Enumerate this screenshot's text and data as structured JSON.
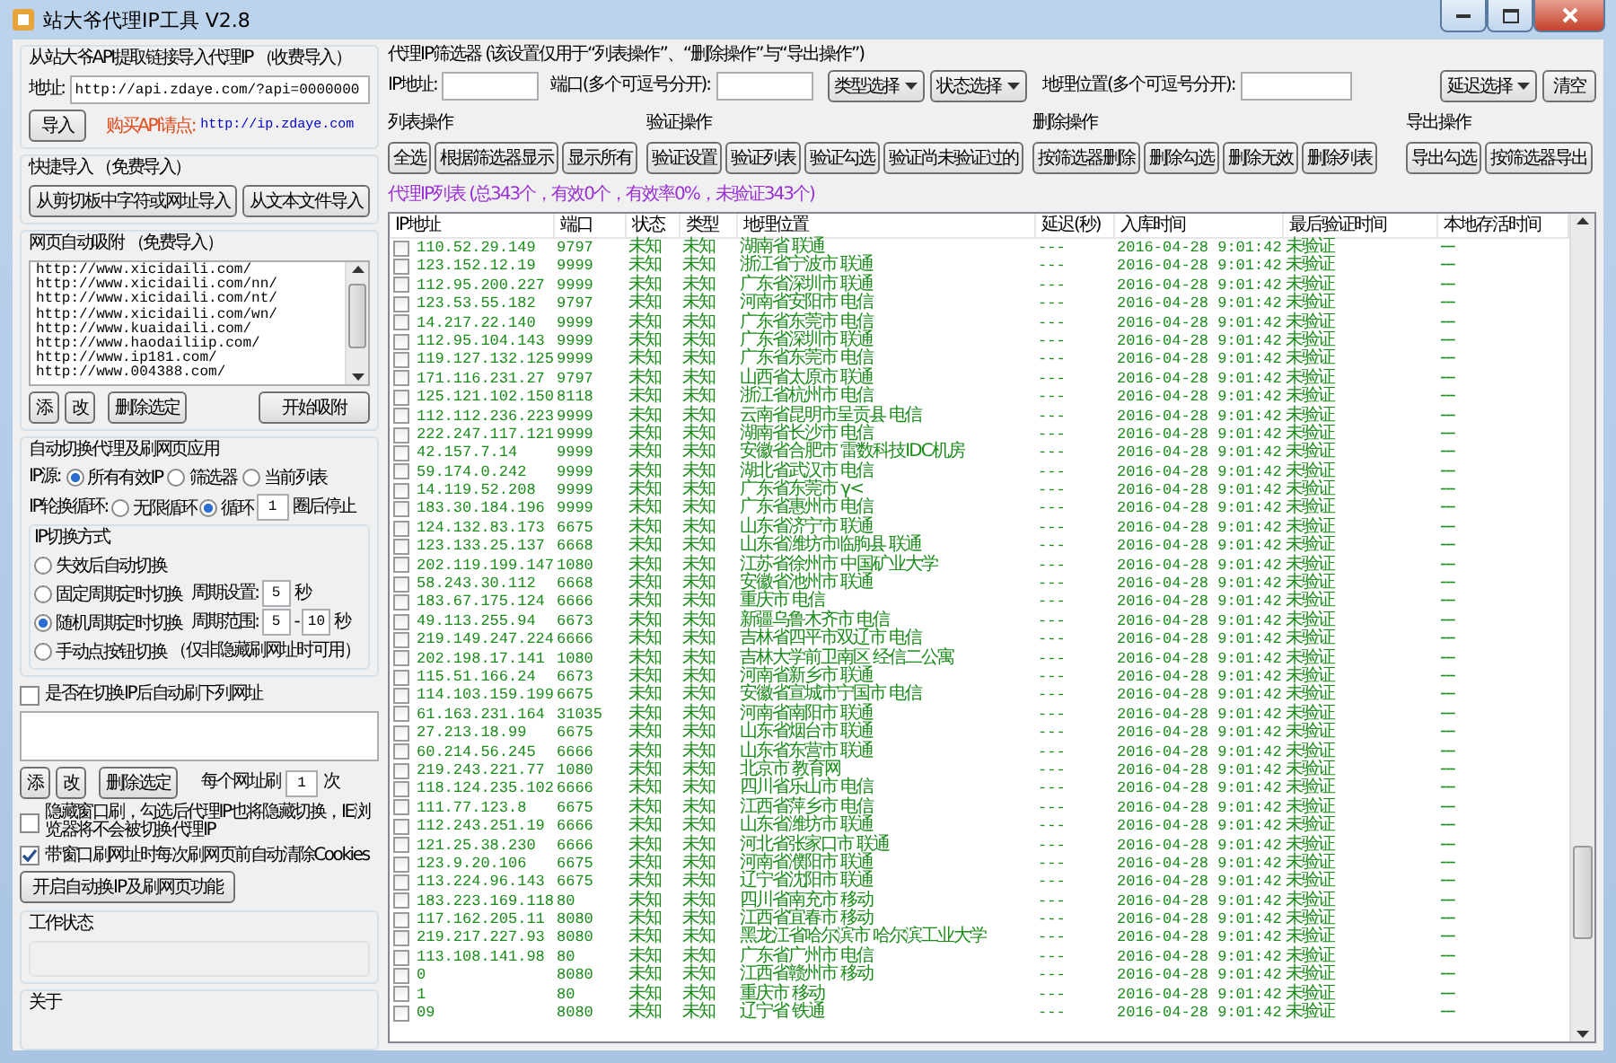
{
  "window": {
    "title": "站大爷代理IP工具 V2.8"
  },
  "api_import": {
    "title": "从站大爷API提取链接导入代理IP （收费导入）",
    "address_label": "地址:",
    "address_value": "http://api.zdaye.com/?api=0000000",
    "import_button": "导入",
    "buy_label": "购买API请点:",
    "buy_link": "http://ip.zdaye.com"
  },
  "quick_import": {
    "title": "快捷导入 （免费导入）",
    "buttons": [
      "从剪切板中字符或网址导入",
      "从文本文件导入"
    ]
  },
  "web_capture": {
    "title": "网页自动吸附 （免费导入）",
    "urls": [
      "http://www.xicidaili.com/",
      "http://www.xicidaili.com/nn/",
      "http://www.xicidaili.com/nt/",
      "http://www.xicidaili.com/wn/",
      "http://www.kuaidaili.com/",
      "http://www.haodailiip.com/",
      "http://www.ip181.com/",
      "http://www.004388.com/"
    ],
    "buttons": [
      "添",
      "改",
      "删除选定"
    ],
    "start_button": "开始吸附"
  },
  "auto_switch": {
    "title": "自动切换代理及刷网页应用",
    "ip_source": {
      "label": "IP源:",
      "options": [
        {
          "label": "所有有效IP",
          "selected": true
        },
        {
          "label": "筛选器",
          "selected": false
        },
        {
          "label": "当前列表",
          "selected": false
        }
      ]
    },
    "rotation": {
      "label": "IP轮换循环:",
      "options": [
        {
          "label": "无限循环",
          "selected": false
        },
        {
          "label": "循环",
          "selected": true
        }
      ],
      "count": "1",
      "suffix": "圈后停止"
    },
    "mode": {
      "title": "IP切换方式",
      "options": [
        {
          "kind": "plain",
          "label": "失效后自动切换",
          "selected": false
        },
        {
          "kind": "fixed",
          "label": "固定周期定时切换",
          "selected": false,
          "field_label": "周期设置:",
          "value": "5",
          "unit": "秒"
        },
        {
          "kind": "range",
          "label": "随机周期定时切换",
          "selected": true,
          "field_label": "周期范围:",
          "from": "5",
          "dash": "-",
          "to": "10",
          "unit": "秒"
        },
        {
          "kind": "note",
          "label": "手动点按钮切换",
          "selected": false,
          "note": "（仅非隐藏刷网址时可用）"
        }
      ]
    }
  },
  "refresh": {
    "checkbox": {
      "label": "是否在切换IP后自动刷下列网址",
      "checked": false
    },
    "buttons": [
      "添",
      "改",
      "删除选定"
    ],
    "count_label": "每个网址刷",
    "count": "1",
    "count_unit": "次"
  },
  "options": [
    {
      "label": "隐藏窗口刷，勾选后代理IP也将隐藏切换，IE浏览器将不会被切换代理IP",
      "checked": false
    },
    {
      "label": "带窗口刷网址时每次刷网页前自动清除Cookies",
      "checked": true
    }
  ],
  "start_button": "开启自动换IP及刷网页功能",
  "status_group": {
    "title": "工作状态"
  },
  "about_group": {
    "title": "关于"
  },
  "filter": {
    "title": "代理IP筛选器 (该设置仅用于“列表操作”、“删除操作”与“导出操作”)",
    "ip_label": "IP地址:",
    "port_label": "端口(多个可逗号分开):",
    "type_select": "类型选择",
    "status_select": "状态选择",
    "location_label": "地理位置(多个可逗号分开):",
    "delay_select": "延迟选择",
    "clear_button": "清空"
  },
  "actions": [
    {
      "title": "列表操作",
      "buttons": [
        "全选",
        "根据筛选器显示",
        "显示所有"
      ]
    },
    {
      "title": "验证操作",
      "buttons": [
        "验证设置",
        "验证列表",
        "验证勾选",
        "验证尚未验证过的"
      ]
    },
    {
      "title": "删除操作",
      "buttons": [
        "按筛选器删除",
        "删除勾选",
        "删除无效",
        "删除列表"
      ]
    },
    {
      "title": "导出操作",
      "buttons": [
        "导出勾选",
        "按筛选器导出"
      ]
    }
  ],
  "list_summary": "代理IP列表 (总343个，有效0个，有效率0%，未验证343个)",
  "table": {
    "columns": [
      "IP地址",
      "端口",
      "状态",
      "类型",
      "地理位置",
      "延迟(秒)",
      "入库时间",
      "最后验证时间",
      "本地存活时间"
    ],
    "rows": [
      {
        "checked": false,
        "cells": [
          "110.52.29.149",
          "9797",
          "未知",
          "未知",
          "湖南省 联通",
          "---",
          "2016-04-28 9:01:42",
          "未验证",
          "---"
        ]
      },
      {
        "checked": false,
        "cells": [
          "123.152.12.19",
          "9999",
          "未知",
          "未知",
          "浙江省宁波市 联通",
          "---",
          "2016-04-28 9:01:42",
          "未验证",
          "---"
        ]
      },
      {
        "checked": false,
        "cells": [
          "112.95.200.227",
          "9999",
          "未知",
          "未知",
          "广东省深圳市 联通",
          "---",
          "2016-04-28 9:01:42",
          "未验证",
          "---"
        ]
      },
      {
        "checked": false,
        "cells": [
          "123.53.55.182",
          "9797",
          "未知",
          "未知",
          "河南省安阳市 电信",
          "---",
          "2016-04-28 9:01:42",
          "未验证",
          "---"
        ]
      },
      {
        "checked": false,
        "cells": [
          "14.217.22.140",
          "9999",
          "未知",
          "未知",
          "广东省东莞市 电信",
          "---",
          "2016-04-28 9:01:42",
          "未验证",
          "---"
        ]
      },
      {
        "checked": false,
        "cells": [
          "112.95.104.143",
          "9999",
          "未知",
          "未知",
          "广东省深圳市 联通",
          "---",
          "2016-04-28 9:01:42",
          "未验证",
          "---"
        ]
      },
      {
        "checked": false,
        "cells": [
          "119.127.132.125",
          "9999",
          "未知",
          "未知",
          "广东省东莞市 电信",
          "---",
          "2016-04-28 9:01:42",
          "未验证",
          "---"
        ]
      },
      {
        "checked": false,
        "cells": [
          "171.116.231.27",
          "9797",
          "未知",
          "未知",
          "山西省太原市 联通",
          "---",
          "2016-04-28 9:01:42",
          "未验证",
          "---"
        ]
      },
      {
        "checked": false,
        "cells": [
          "125.121.102.150",
          "8118",
          "未知",
          "未知",
          "浙江省杭州市 电信",
          "---",
          "2016-04-28 9:01:42",
          "未验证",
          "---"
        ]
      },
      {
        "checked": false,
        "cells": [
          "112.112.236.223",
          "9999",
          "未知",
          "未知",
          "云南省昆明市呈贡县 电信",
          "---",
          "2016-04-28 9:01:42",
          "未验证",
          "---"
        ]
      },
      {
        "checked": false,
        "cells": [
          "222.247.117.121",
          "9999",
          "未知",
          "未知",
          "湖南省长沙市 电信",
          "---",
          "2016-04-28 9:01:42",
          "未验证",
          "---"
        ]
      },
      {
        "checked": false,
        "cells": [
          "42.157.7.14",
          "9999",
          "未知",
          "未知",
          "安徽省合肥市 雷数科技IDC机房",
          "---",
          "2016-04-28 9:01:42",
          "未验证",
          "---"
        ]
      },
      {
        "checked": false,
        "cells": [
          "59.174.0.242",
          "9999",
          "未知",
          "未知",
          "湖北省武汉市 电信",
          "---",
          "2016-04-28 9:01:42",
          "未验证",
          "---"
        ]
      },
      {
        "checked": false,
        "cells": [
          "14.119.52.208",
          "9999",
          "未知",
          "未知",
          "广东省东莞市 γ<",
          "---",
          "2016-04-28 9:01:42",
          "未验证",
          "---"
        ]
      },
      {
        "checked": false,
        "cells": [
          "183.30.184.196",
          "9999",
          "未知",
          "未知",
          "广东省惠州市 电信",
          "---",
          "2016-04-28 9:01:42",
          "未验证",
          "---"
        ]
      },
      {
        "checked": false,
        "cells": [
          "124.132.83.173",
          "6675",
          "未知",
          "未知",
          "山东省济宁市 联通",
          "---",
          "2016-04-28 9:01:42",
          "未验证",
          "---"
        ]
      },
      {
        "checked": false,
        "cells": [
          "123.133.25.137",
          "6668",
          "未知",
          "未知",
          "山东省潍坊市临朐县 联通",
          "---",
          "2016-04-28 9:01:42",
          "未验证",
          "---"
        ]
      },
      {
        "checked": false,
        "cells": [
          "202.119.199.147",
          "1080",
          "未知",
          "未知",
          "江苏省徐州市 中国矿业大学",
          "---",
          "2016-04-28 9:01:42",
          "未验证",
          "---"
        ]
      },
      {
        "checked": false,
        "cells": [
          "58.243.30.112",
          "6668",
          "未知",
          "未知",
          "安徽省池州市 联通",
          "---",
          "2016-04-28 9:01:42",
          "未验证",
          "---"
        ]
      },
      {
        "checked": false,
        "cells": [
          "183.67.175.124",
          "6666",
          "未知",
          "未知",
          "重庆市 电信",
          "---",
          "2016-04-28 9:01:42",
          "未验证",
          "---"
        ]
      },
      {
        "checked": false,
        "cells": [
          "49.113.255.94",
          "6673",
          "未知",
          "未知",
          "新疆乌鲁木齐市 电信",
          "---",
          "2016-04-28 9:01:42",
          "未验证",
          "---"
        ]
      },
      {
        "checked": false,
        "cells": [
          "219.149.247.224",
          "6666",
          "未知",
          "未知",
          "吉林省四平市双辽市 电信",
          "---",
          "2016-04-28 9:01:42",
          "未验证",
          "---"
        ]
      },
      {
        "checked": false,
        "cells": [
          "202.198.17.141",
          "1080",
          "未知",
          "未知",
          "吉林大学前卫南区 经信二公寓",
          "---",
          "2016-04-28 9:01:42",
          "未验证",
          "---"
        ]
      },
      {
        "checked": false,
        "cells": [
          "115.51.166.24",
          "6673",
          "未知",
          "未知",
          "河南省新乡市 联通",
          "---",
          "2016-04-28 9:01:42",
          "未验证",
          "---"
        ]
      },
      {
        "checked": false,
        "cells": [
          "114.103.159.199",
          "6675",
          "未知",
          "未知",
          "安徽省宣城市宁国市 电信",
          "---",
          "2016-04-28 9:01:42",
          "未验证",
          "---"
        ]
      },
      {
        "checked": false,
        "cells": [
          "61.163.231.164",
          "31035",
          "未知",
          "未知",
          "河南省南阳市 联通",
          "---",
          "2016-04-28 9:01:42",
          "未验证",
          "---"
        ]
      },
      {
        "checked": false,
        "cells": [
          "27.213.18.99",
          "6675",
          "未知",
          "未知",
          "山东省烟台市 联通",
          "---",
          "2016-04-28 9:01:42",
          "未验证",
          "---"
        ]
      },
      {
        "checked": false,
        "cells": [
          "60.214.56.245",
          "6666",
          "未知",
          "未知",
          "山东省东营市 联通",
          "---",
          "2016-04-28 9:01:42",
          "未验证",
          "---"
        ]
      },
      {
        "checked": false,
        "cells": [
          "219.243.221.77",
          "1080",
          "未知",
          "未知",
          "北京市 教育网",
          "---",
          "2016-04-28 9:01:42",
          "未验证",
          "---"
        ]
      },
      {
        "checked": false,
        "cells": [
          "118.124.235.102",
          "6666",
          "未知",
          "未知",
          "四川省乐山市 电信",
          "---",
          "2016-04-28 9:01:42",
          "未验证",
          "---"
        ]
      },
      {
        "checked": false,
        "cells": [
          "111.77.123.8",
          "6675",
          "未知",
          "未知",
          "江西省萍乡市 电信",
          "---",
          "2016-04-28 9:01:42",
          "未验证",
          "---"
        ]
      },
      {
        "checked": false,
        "cells": [
          "112.243.251.19",
          "6666",
          "未知",
          "未知",
          "山东省潍坊市 联通",
          "---",
          "2016-04-28 9:01:42",
          "未验证",
          "---"
        ]
      },
      {
        "checked": false,
        "cells": [
          "121.25.38.230",
          "6666",
          "未知",
          "未知",
          "河北省张家口市 联通",
          "---",
          "2016-04-28 9:01:42",
          "未验证",
          "---"
        ]
      },
      {
        "checked": false,
        "cells": [
          "123.9.20.106",
          "6675",
          "未知",
          "未知",
          "河南省濮阳市 联通",
          "---",
          "2016-04-28 9:01:42",
          "未验证",
          "---"
        ]
      },
      {
        "checked": false,
        "cells": [
          "113.224.96.143",
          "6675",
          "未知",
          "未知",
          "辽宁省沈阳市 联通",
          "---",
          "2016-04-28 9:01:42",
          "未验证",
          "---"
        ]
      },
      {
        "checked": false,
        "cells": [
          "183.223.169.118",
          "80",
          "未知",
          "未知",
          "四川省南充市 移动",
          "---",
          "2016-04-28 9:01:42",
          "未验证",
          "---"
        ]
      },
      {
        "checked": false,
        "cells": [
          "117.162.205.11",
          "8080",
          "未知",
          "未知",
          "江西省宜春市 移动",
          "---",
          "2016-04-28 9:01:42",
          "未验证",
          "---"
        ]
      },
      {
        "checked": false,
        "cells": [
          "219.217.227.93",
          "8080",
          "未知",
          "未知",
          "黑龙江省哈尔滨市 哈尔滨工业大学",
          "---",
          "2016-04-28 9:01:42",
          "未验证",
          "---"
        ]
      },
      {
        "checked": false,
        "cells": [
          "113.108.141.98",
          "80",
          "未知",
          "未知",
          "广东省广州市 电信",
          "---",
          "2016-04-28 9:01:42",
          "未验证",
          "---"
        ]
      },
      {
        "checked": false,
        "cells": [
          "0",
          "8080",
          "未知",
          "未知",
          "江西省赣州市 移动",
          "---",
          "2016-04-28 9:01:42",
          "未验证",
          "---"
        ]
      },
      {
        "checked": false,
        "cells": [
          "1",
          "80",
          "未知",
          "未知",
          "重庆市 移动",
          "---",
          "2016-04-28 9:01:42",
          "未验证",
          "---"
        ]
      },
      {
        "checked": false,
        "cells": [
          "09",
          "8080",
          "未知",
          "未知",
          "辽宁省 铁通",
          "---",
          "2016-04-28 9:01:42",
          "未验证",
          "---"
        ]
      }
    ]
  }
}
